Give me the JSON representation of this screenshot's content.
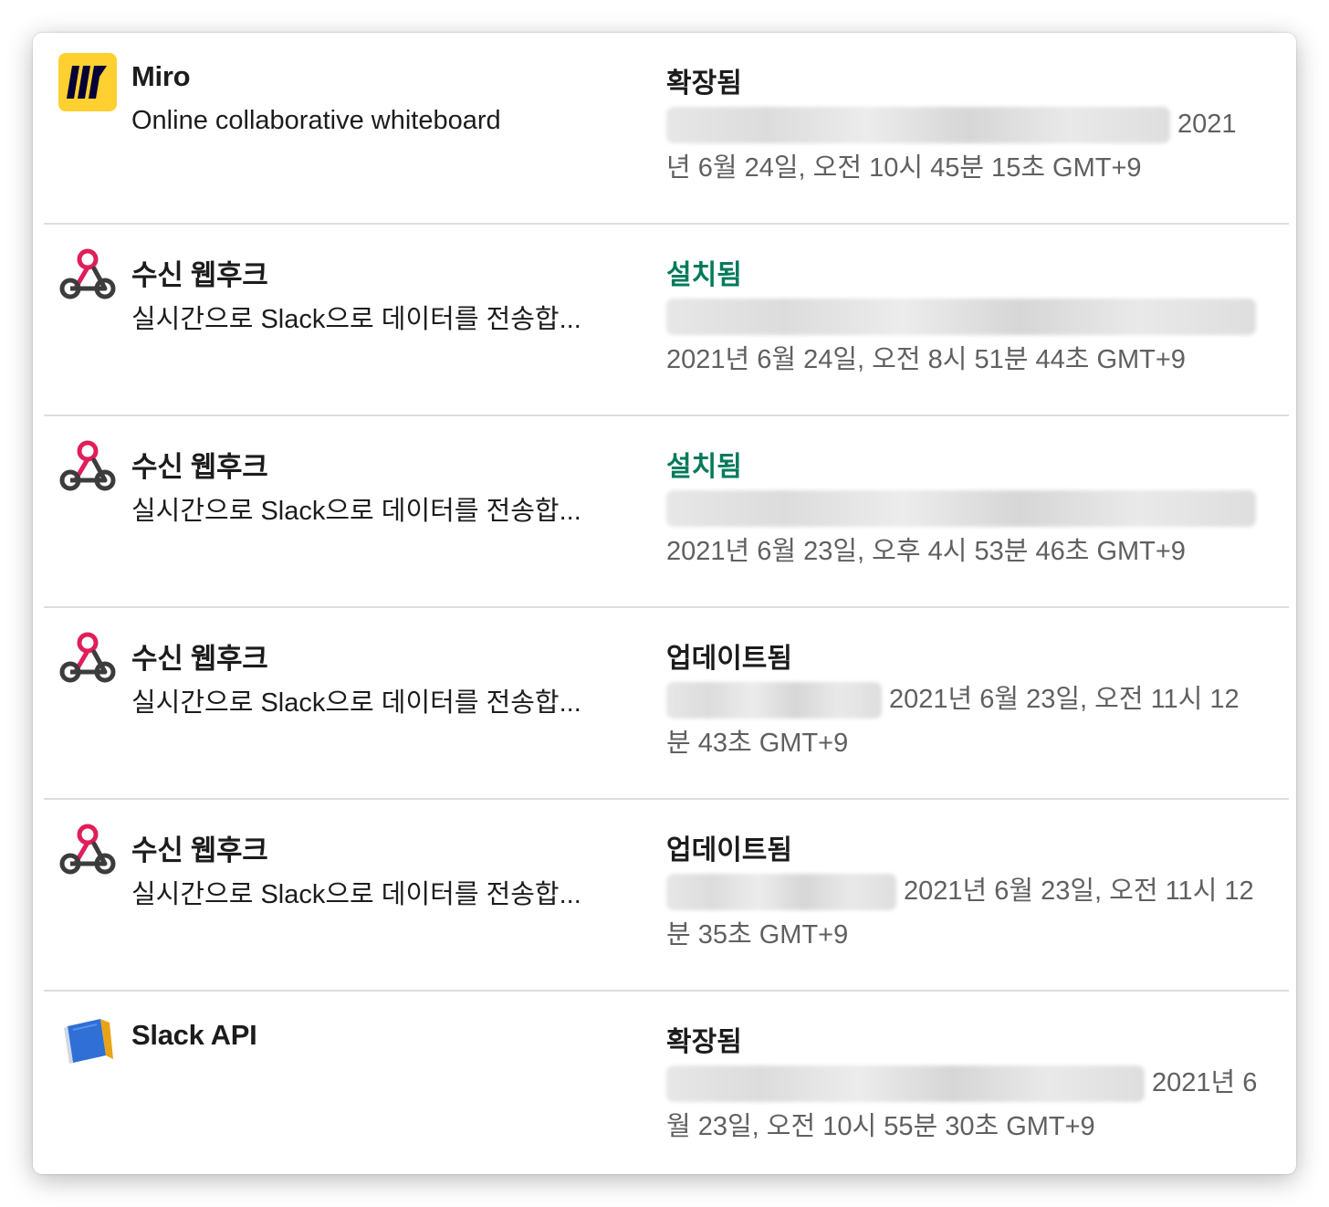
{
  "rows": [
    {
      "name": "Miro",
      "description": "Online collaborative whiteboard",
      "status": "확장됨",
      "status_color": "#1d1c1d",
      "date_text": "2021년 6월 24일, 오전 10시 45분 15초 GMT+9",
      "icon": "miro-logo-icon"
    },
    {
      "name": "수신 웹후크",
      "description": "실시간으로 Slack으로 데이터를 전송합...",
      "status": "설치됨",
      "status_color": "#007a5a",
      "date_text": "2021년 6월 24일, 오전 8시 51분 44초 GMT+9",
      "icon": "webhook-icon"
    },
    {
      "name": "수신 웹후크",
      "description": "실시간으로 Slack으로 데이터를 전송합...",
      "status": "설치됨",
      "status_color": "#007a5a",
      "date_text": "2021년 6월 23일, 오후 4시 53분 46초 GMT+9",
      "icon": "webhook-icon"
    },
    {
      "name": "수신 웹후크",
      "description": "실시간으로 Slack으로 데이터를 전송합...",
      "status": "업데이트됨",
      "status_color": "#1d1c1d",
      "date_text": "2021년 6월 23일, 오전 11시 12분 43초 GMT+9",
      "icon": "webhook-icon"
    },
    {
      "name": "수신 웹후크",
      "description": "실시간으로 Slack으로 데이터를 전송합...",
      "status": "업데이트됨",
      "status_color": "#1d1c1d",
      "date_text": "2021년 6월 23일, 오전 11시 12분 35초 GMT+9",
      "icon": "webhook-icon"
    },
    {
      "name": "Slack API",
      "description": "",
      "status": "확장됨",
      "status_color": "#1d1c1d",
      "date_text": "2021년 6월 23일, 오전 10시 55분 30초 GMT+9",
      "icon": "slack-api-book-icon"
    }
  ]
}
